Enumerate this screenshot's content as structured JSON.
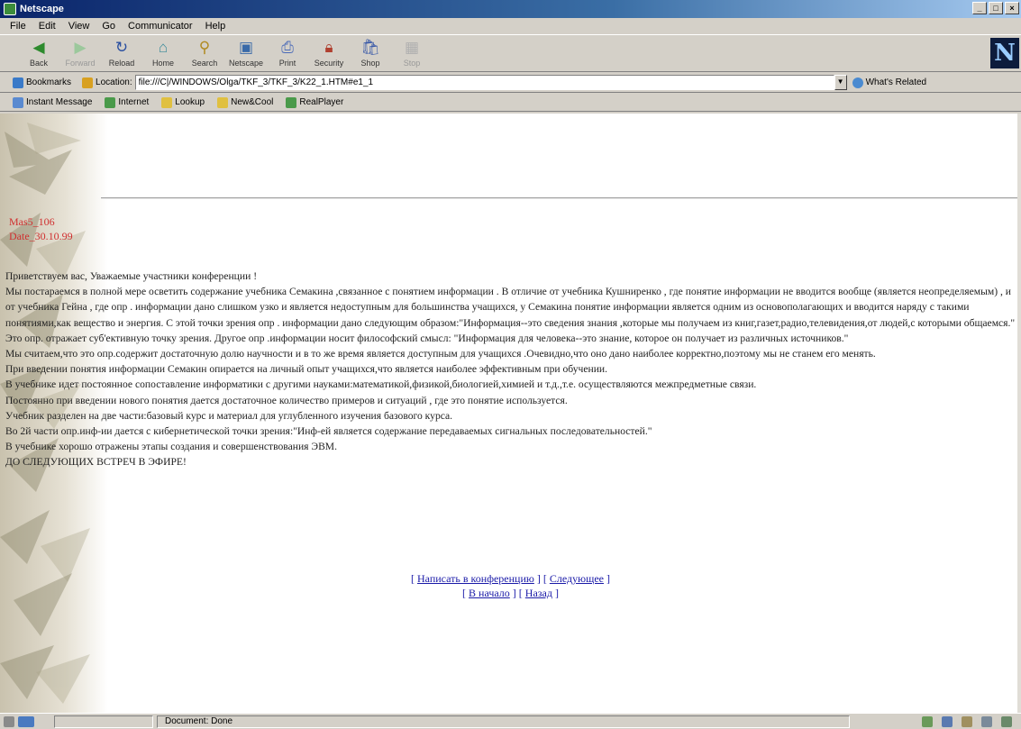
{
  "window": {
    "title": "Netscape"
  },
  "menu": [
    "File",
    "Edit",
    "View",
    "Go",
    "Communicator",
    "Help"
  ],
  "nav_buttons": [
    {
      "label": "Back",
      "icon": "back-icon",
      "enabled": true
    },
    {
      "label": "Forward",
      "icon": "forward-icon",
      "enabled": false
    },
    {
      "label": "Reload",
      "icon": "reload-icon",
      "enabled": true
    },
    {
      "label": "Home",
      "icon": "home-icon",
      "enabled": true
    },
    {
      "label": "Search",
      "icon": "search-icon",
      "enabled": true
    },
    {
      "label": "Netscape",
      "icon": "netscape-icon",
      "enabled": true
    },
    {
      "label": "Print",
      "icon": "print-icon",
      "enabled": true
    },
    {
      "label": "Security",
      "icon": "security-icon",
      "enabled": true
    },
    {
      "label": "Shop",
      "icon": "shop-icon",
      "enabled": true
    },
    {
      "label": "Stop",
      "icon": "stop-icon",
      "enabled": false
    }
  ],
  "location": {
    "bookmarks_label": "Bookmarks",
    "location_label": "Location:",
    "url": "file:///C|/WINDOWS/Olga/TKF_3/TKF_3/K22_1.HTM#e1_1",
    "whats_related": "What's Related"
  },
  "personal_toolbar": [
    "Instant Message",
    "Internet",
    "Lookup",
    "New&Cool",
    "RealPlayer"
  ],
  "page": {
    "meta_lines": [
      "Mas5_106",
      "Date_30.10.99"
    ],
    "paragraphs": [
      "Приветствуем вас, Уважаемые участники конференции !",
      "Мы постараемся в полной мере осветить содержание учебника Семакина ,связанное с понятием информации . В отличие от учебника Кушниренко , где понятие информации не вводится вообще (является неопределяемым) , и от учебника Гейна , где опр . информации дано слишком узко и является недоступным для большинства учащихся, у Семакина понятие информации является одним из основополагающих и вводится наряду с такими понятиями,как вещество и энергия. С этой точки зрения опр . информации дано следующим образом:\"Информация--это сведения знания ,которые мы получаем из книг,газет,радио,телевидения,от людей,с которыми общаемся.\"",
      "Это опр. отражает суб'ективную точку зрения. Другое опр .информации носит философский смысл: \"Информация для человека--это знание, которое он получает из различных источников.\"",
      "Мы считаем,что это опр.содержит достаточную долю научности и в то же время является доступным для учащихся .Очевидно,что оно дано наиболее корректно,поэтому мы не станем его менять.",
      "При введении понятия информации Семакин опирается на личный опыт учащихся,что является наиболее эффективным при обучении.",
      "В учебнике идет постоянное сопоставление информатики с другими науками:математикой,физикой,биологией,химией и т.д.,т.е. осуществляются межпредметные связи.",
      "Постоянно при введении нового понятия дается достаточное количество примеров и ситуаций , где это понятие используется.",
      "Учебник разделен на две части:базовый курс и материал для углубленного изучения базового курса.",
      "Во 2й части опр.инф-ии дается с кибернетической точки зрения:\"Инф-ей является содержание передаваемых сигнальных последовательностей.\"",
      "В учебнике хорошо отражены этапы создания и совершенствования ЭВМ.",
      "ДО СЛЕДУЮЩИХ ВСТРЕЧ В ЭФИРЕ!"
    ],
    "links_row1": [
      "Написать в конференцию",
      "Следующее"
    ],
    "links_row2": [
      "В начало",
      "Назад"
    ]
  },
  "status": {
    "text": "Document: Done"
  },
  "colors": {
    "link": "#1a1aa8",
    "meta": "#d03030",
    "chrome": "#d4d0c8"
  }
}
